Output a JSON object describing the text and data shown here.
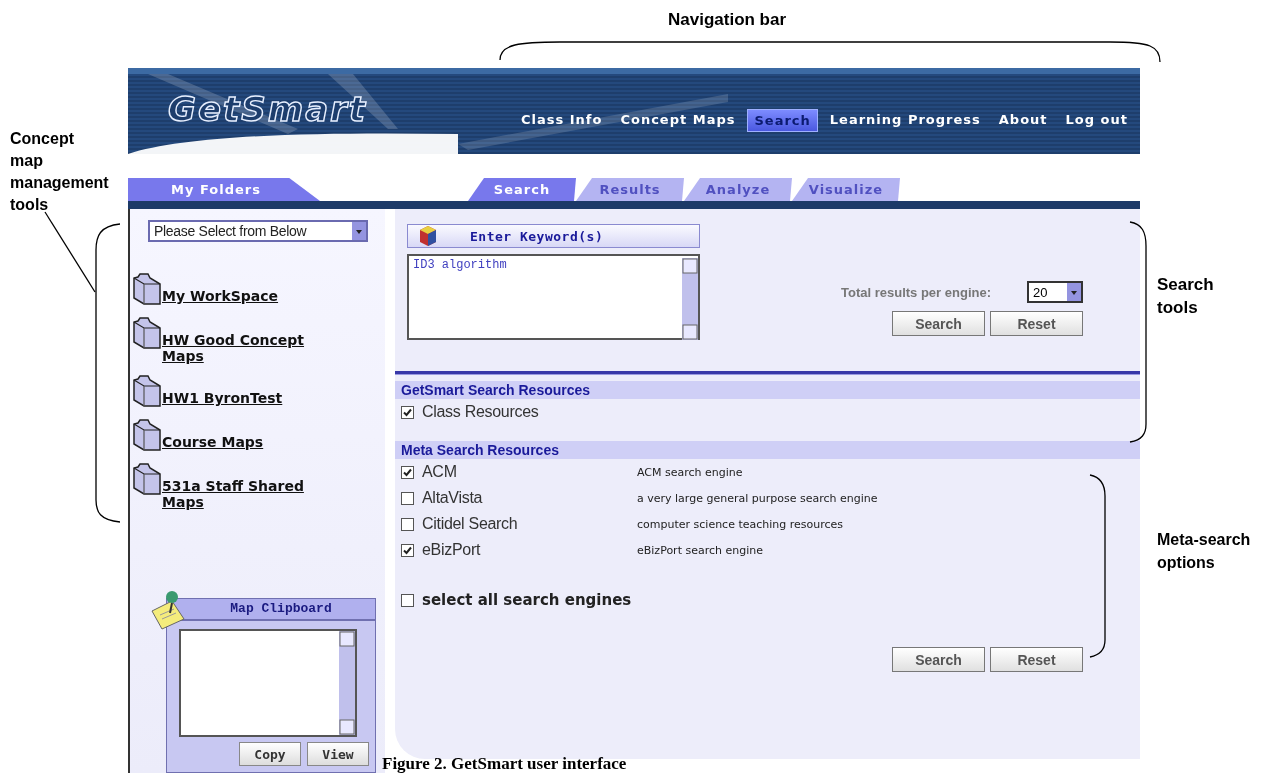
{
  "callouts": {
    "navigation_bar": "Navigation bar",
    "concept_map_tools": "Concept map management tools",
    "search_tools": "Search tools",
    "meta_search_options": "Meta-search options"
  },
  "header": {
    "logo": "GetSmart",
    "nav": [
      {
        "label": "Class Info",
        "selected": false
      },
      {
        "label": "Concept Maps",
        "selected": false
      },
      {
        "label": "Search",
        "selected": true
      },
      {
        "label": "Learning Progress",
        "selected": false
      },
      {
        "label": "About",
        "selected": false
      },
      {
        "label": "Log out",
        "selected": false
      }
    ]
  },
  "folder_tab": {
    "label": "My Folders",
    "selected": true
  },
  "tabs": [
    {
      "label": "Search",
      "selected": true
    },
    {
      "label": "Results",
      "selected": false
    },
    {
      "label": "Analyze",
      "selected": false
    },
    {
      "label": "Visualize",
      "selected": false
    }
  ],
  "sidebar": {
    "folder_select": "Please Select from Below",
    "folders": [
      {
        "label": "My WorkSpace"
      },
      {
        "label": "HW Good Concept Maps"
      },
      {
        "label": "HW1 ByronTest"
      },
      {
        "label": "Course Maps"
      },
      {
        "label": "531a Staff Shared Maps"
      }
    ],
    "clipboard": {
      "title": "Map Clipboard",
      "buttons": [
        "Copy",
        "View"
      ]
    }
  },
  "search": {
    "keyword_title": "Enter Keyword(s)",
    "keyword_value": "ID3 algorithm",
    "results_label": "Total results per engine:",
    "results_value": "20",
    "buttons": [
      "Search",
      "Reset"
    ]
  },
  "getsmart_resources": {
    "title": "GetSmart Search Resources",
    "items": [
      {
        "label": "Class Resources",
        "checked": true
      }
    ]
  },
  "meta_resources": {
    "title": "Meta Search Resources",
    "engines": [
      {
        "name": "ACM",
        "description": "ACM search engine",
        "checked": true
      },
      {
        "name": "AltaVista",
        "description": "a very large general purpose search engine",
        "checked": false
      },
      {
        "name": "Citidel Search",
        "description": "computer science teaching resources",
        "checked": false
      },
      {
        "name": "eBizPort",
        "description": "eBizPort search engine",
        "checked": true
      }
    ],
    "select_all": {
      "label": "select all search engines",
      "checked": false
    },
    "buttons": [
      "Search",
      "Reset"
    ]
  },
  "caption": "Figure 2. GetSmart user interface"
}
